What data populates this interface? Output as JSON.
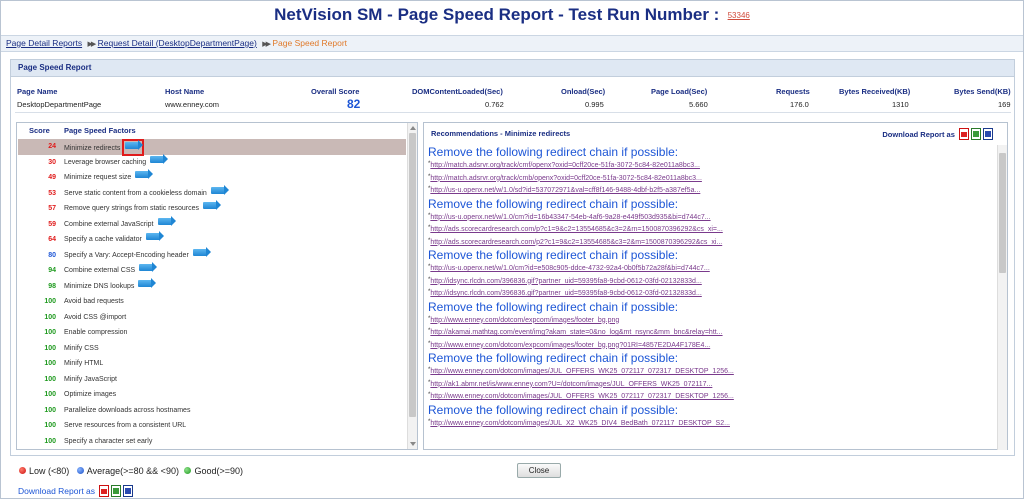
{
  "header": {
    "title": "NetVision SM - Page Speed Report - Test Run Number :",
    "run_number": "53346"
  },
  "breadcrumb": {
    "items": [
      "Page Detail Reports",
      "Request Detail (DesktopDepartmentPage)"
    ],
    "separator": "▶▶",
    "current": "Page Speed Report"
  },
  "panel": {
    "title": "Page Speed Report"
  },
  "summary": {
    "headers": [
      "Page Name",
      "Host Name",
      "Overall Score",
      "DOMContentLoaded(Sec)",
      "Onload(Sec)",
      "Page Load(Sec)",
      "Requests",
      "Bytes Received(KB)",
      "Bytes Send(KB)"
    ],
    "values": [
      "DesktopDepartmentPage",
      "www.enney.com",
      "82",
      "0.762",
      "0.995",
      "5.660",
      "176.0",
      "1310",
      "169"
    ]
  },
  "factors": {
    "col_score": "Score",
    "col_name": "Page Speed Factors",
    "items": [
      {
        "score": "24",
        "name": "Minimize redirects",
        "color": "#e01b1b",
        "arrow": true
      },
      {
        "score": "30",
        "name": "Leverage browser caching",
        "color": "#e01b1b",
        "arrow": true
      },
      {
        "score": "49",
        "name": "Minimize request size",
        "color": "#e01b1b",
        "arrow": true
      },
      {
        "score": "53",
        "name": "Serve static content from a cookieless domain",
        "color": "#e01b1b",
        "arrow": true
      },
      {
        "score": "57",
        "name": "Remove query strings from static resources",
        "color": "#e01b1b",
        "arrow": true
      },
      {
        "score": "59",
        "name": "Combine external JavaScript",
        "color": "#e01b1b",
        "arrow": true
      },
      {
        "score": "64",
        "name": "Specify a cache validator",
        "color": "#e01b1b",
        "arrow": true
      },
      {
        "score": "80",
        "name": "Specify a Vary: Accept-Encoding header",
        "color": "#1d56d6",
        "arrow": true
      },
      {
        "score": "94",
        "name": "Combine external CSS",
        "color": "#1f9a1f",
        "arrow": true
      },
      {
        "score": "98",
        "name": "Minimize DNS lookups",
        "color": "#1f9a1f",
        "arrow": true
      },
      {
        "score": "100",
        "name": "Avoid bad requests",
        "color": "#1f9a1f",
        "arrow": false
      },
      {
        "score": "100",
        "name": "Avoid CSS @import",
        "color": "#1f9a1f",
        "arrow": false
      },
      {
        "score": "100",
        "name": "Enable compression",
        "color": "#1f9a1f",
        "arrow": false
      },
      {
        "score": "100",
        "name": "Minify CSS",
        "color": "#1f9a1f",
        "arrow": false
      },
      {
        "score": "100",
        "name": "Minify HTML",
        "color": "#1f9a1f",
        "arrow": false
      },
      {
        "score": "100",
        "name": "Minify JavaScript",
        "color": "#1f9a1f",
        "arrow": false
      },
      {
        "score": "100",
        "name": "Optimize images",
        "color": "#1f9a1f",
        "arrow": false
      },
      {
        "score": "100",
        "name": "Parallelize downloads across hostnames",
        "color": "#1f9a1f",
        "arrow": false
      },
      {
        "score": "100",
        "name": "Serve resources from a consistent URL",
        "color": "#1f9a1f",
        "arrow": false
      },
      {
        "score": "100",
        "name": "Specify a character set early",
        "color": "#1f9a1f",
        "arrow": false
      }
    ],
    "selected_index": 0
  },
  "recommendations": {
    "title": "Recommendations - Minimize redirects",
    "download_label": "Download Report as",
    "chains": [
      {
        "title": "Remove the following redirect chain if possible:",
        "urls": [
          "http://match.adsrvr.org/track/cmf/openx?oxid=0cff20ce-51fa-3072-5c84-82e011a8bc3...",
          "http://match.adsrvr.org/track/cmb/openx?oxid=0cff20ce-51fa-3072-5c84-82e011a8bc3...",
          "http://us-u.openx.net/w/1.0/sd?id=537072971&val=cff8f146-9488-4dbf-b2f5-a387ef5a..."
        ]
      },
      {
        "title": "Remove the following redirect chain if possible:",
        "urls": [
          "http://us-u.openx.net/w/1.0/cm?id=16b43347-54eb-4af6-9a28-e449f503d935&bi=d744c7...",
          "http://ads.scorecardresearch.com/p?c1=9&c2=13554685&c3=2&rn=1500870396292&cs_xi=...",
          "http://ads.scorecardresearch.com/p2?c1=9&c2=13554685&c3=2&m=1500870396292&cs_xi..."
        ]
      },
      {
        "title": "Remove the following redirect chain if possible:",
        "urls": [
          "http://us-u.openx.net/w/1.0/cm?id=e508c905-ddce-4732-92a4-0b0f5b72a28f&bi=d744c7...",
          "http://idsync.rlcdn.com/396836.gif?partner_uid=59395fa8-9cbd-0612-03fd-02132833d...",
          "http://idsync.rlcdn.com/396836.gif?partner_uid=59395fa8-9cbd-0612-03fd-02132833d..."
        ]
      },
      {
        "title": "Remove the following redirect chain if possible:",
        "urls": [
          "http://www.enney.com/dotcom/expcom/images/footer_bg.png",
          "http://akamai.mathtag.com/event/img?akam_state=0&no_log&mt_nsync&mm_bnc&relay=htt...",
          "http://www.enney.com/dotcom/expcom/images/footer_bg.png?01RI=4857E2DA4F178E4..."
        ]
      },
      {
        "title": "Remove the following redirect chain if possible:",
        "urls": [
          "http://www.enney.com/dotcom/images/JUL_OFFERS_WK25_072117_072317_DESKTOP_1256...",
          "http://ak1.abmr.net/is/www.enney.com?U=/dotcom/images/JUL_OFFERS_WK25_072117...",
          "http://www.enney.com/dotcom/images/JUL_OFFERS_WK25_072117_072317_DESKTOP_1256..."
        ]
      },
      {
        "title": "Remove the following redirect chain if possible:",
        "urls": [
          "http://www.enney.com/dotcom/images/JUL_X2_WK25_DIV4_BedBath_072117_DESKTOP_S2..."
        ]
      }
    ]
  },
  "legend": {
    "low": "Low (<80)",
    "average": "Average(>=80 && <90)",
    "good": "Good(>=90)"
  },
  "footer": {
    "close_label": "Close",
    "download_label": "Download Report as"
  },
  "icons": {
    "pdf": "pdf-file-icon",
    "excel": "excel-file-icon",
    "word": "word-file-icon",
    "arrow": "blue-arrow-icon"
  }
}
